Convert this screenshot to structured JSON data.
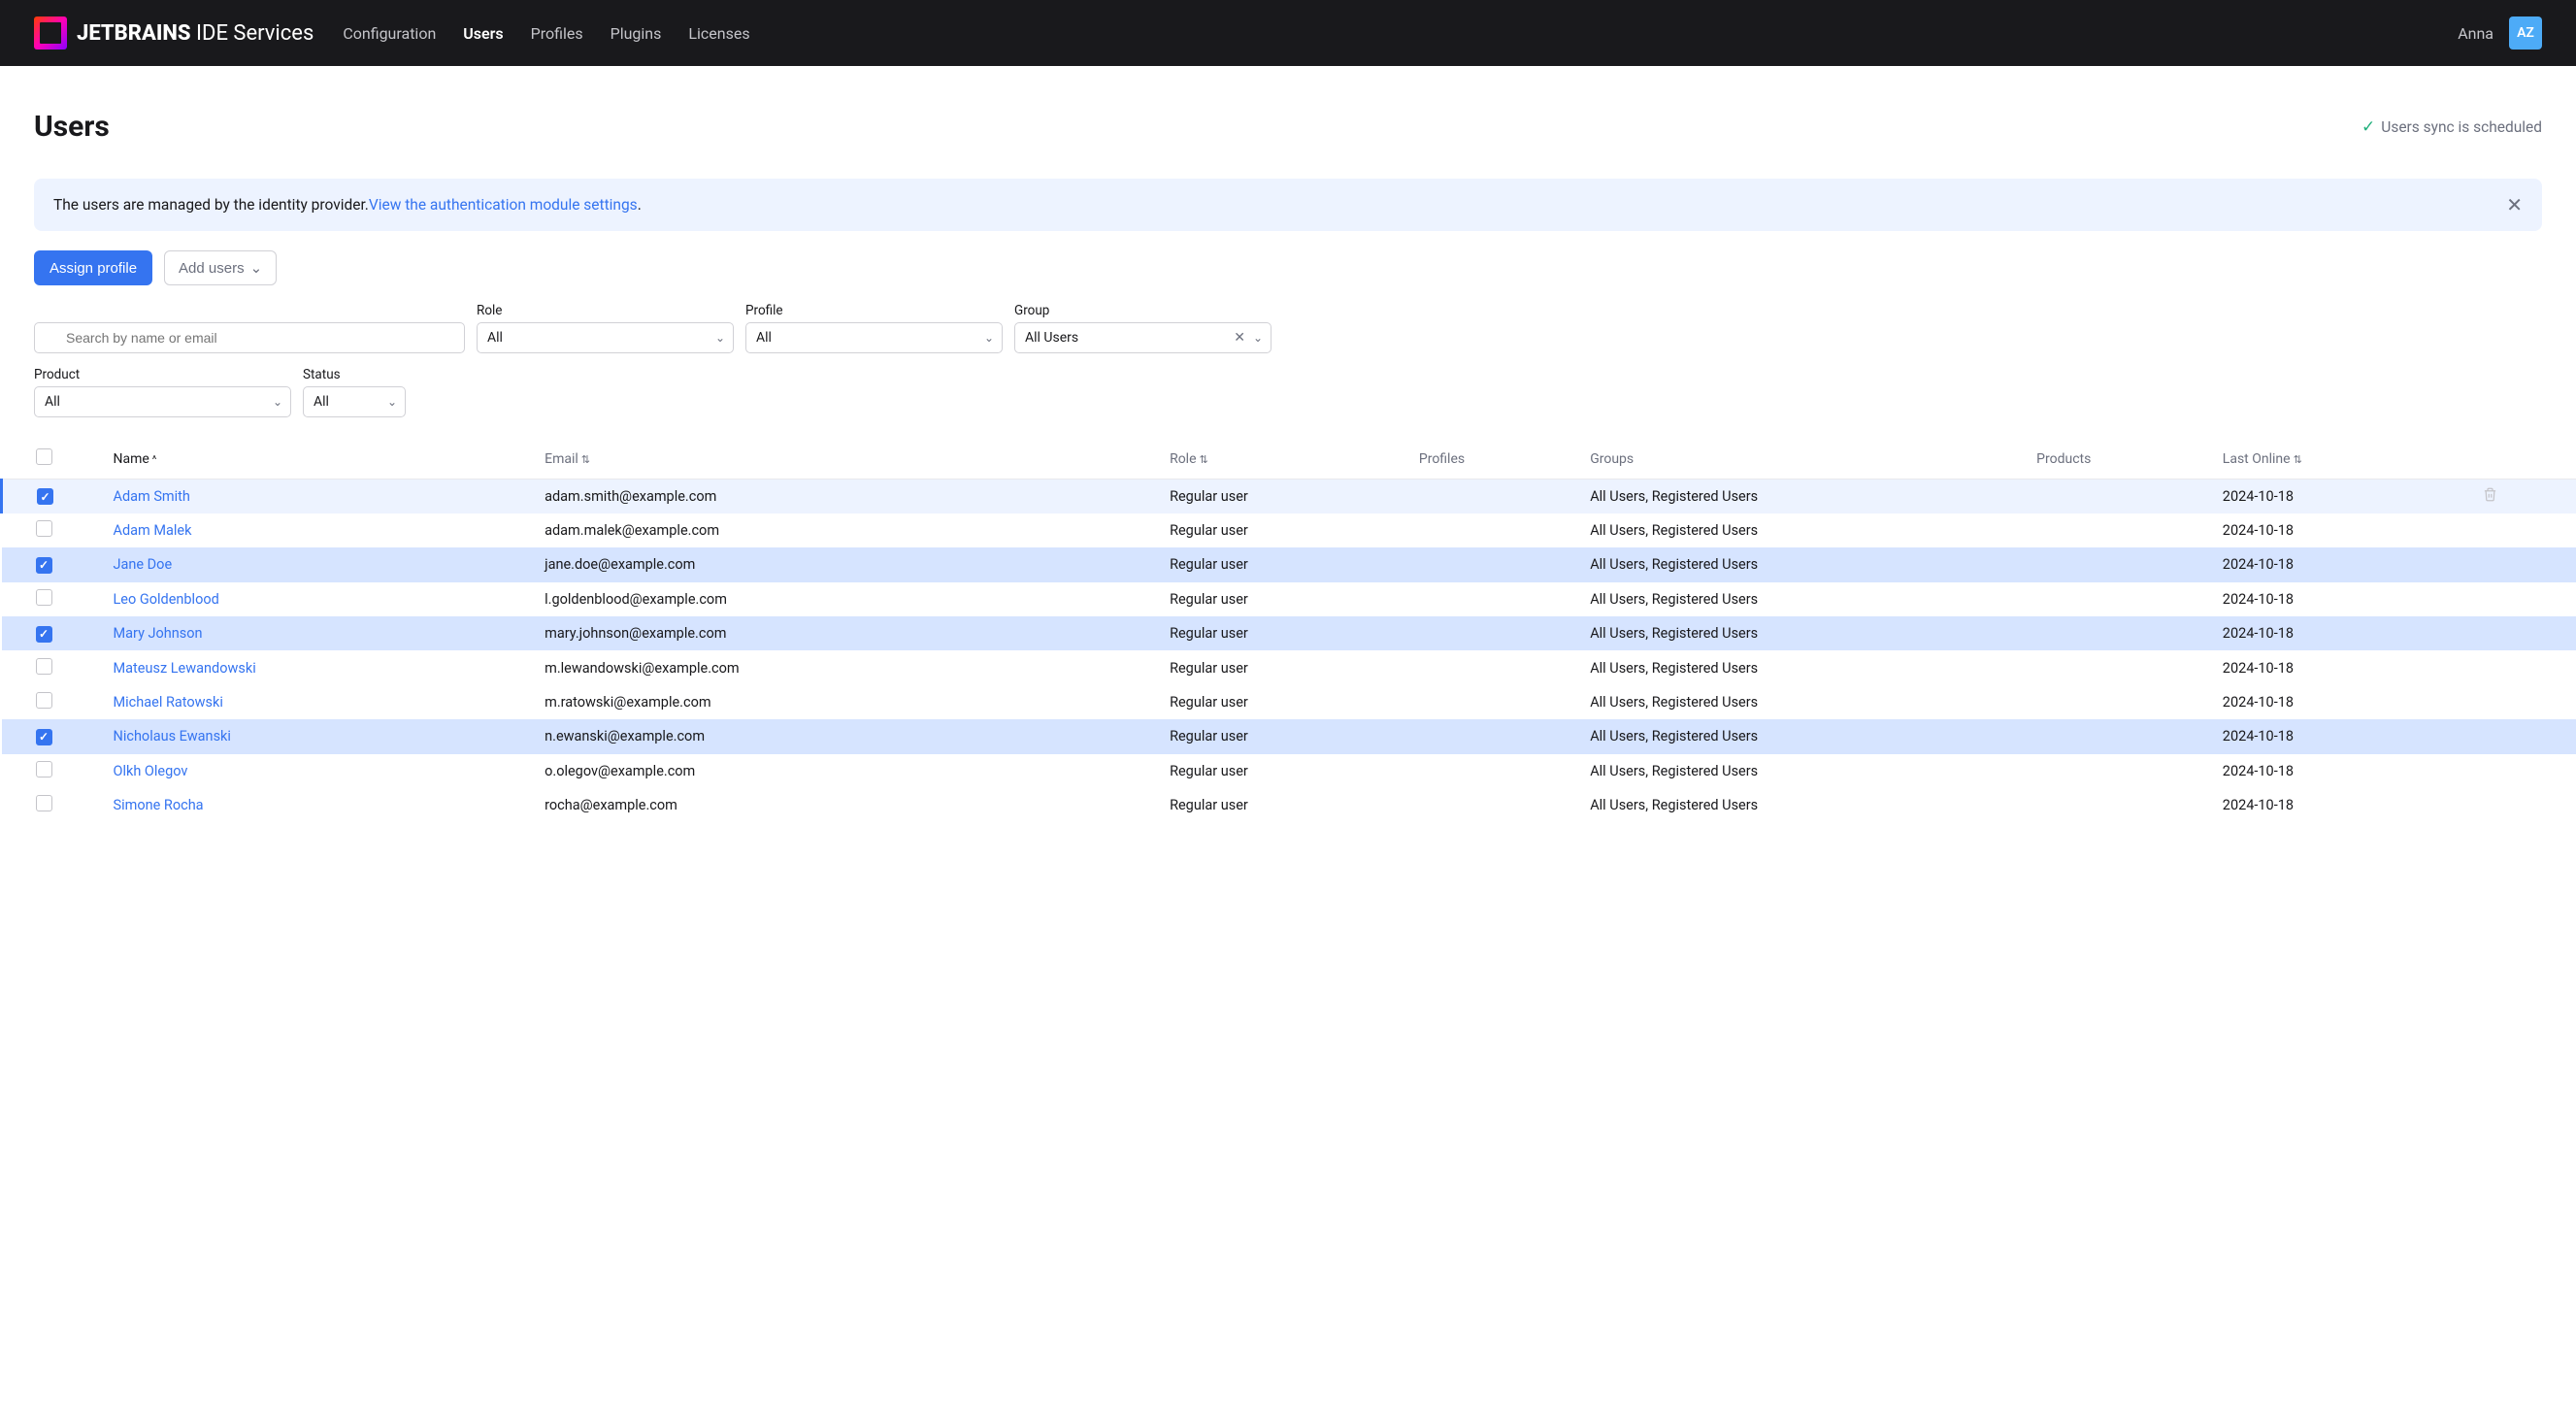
{
  "header": {
    "logo_bold": "JETBRAINS",
    "logo_rest": " IDE Services",
    "nav": [
      "Configuration",
      "Users",
      "Profiles",
      "Plugins",
      "Licenses"
    ],
    "active_nav": "Users",
    "user_name": "Anna",
    "avatar": "AZ"
  },
  "page": {
    "title": "Users",
    "sync_status": "Users sync is scheduled"
  },
  "banner": {
    "text_prefix": "The users are managed by the identity provider. ",
    "link_text": "View the authentication module settings",
    "text_suffix": "."
  },
  "actions": {
    "assign_profile": "Assign profile",
    "add_users": "Add users"
  },
  "filters": {
    "search_placeholder": "Search by name or email",
    "role_label": "Role",
    "role_value": "All",
    "profile_label": "Profile",
    "profile_value": "All",
    "group_label": "Group",
    "group_value": "All Users",
    "product_label": "Product",
    "product_value": "All",
    "status_label": "Status",
    "status_value": "All"
  },
  "columns": {
    "name": "Name",
    "email": "Email",
    "role": "Role",
    "profiles": "Profiles",
    "groups": "Groups",
    "products": "Products",
    "last_online": "Last Online"
  },
  "rows": [
    {
      "selected": true,
      "hover": true,
      "name": "Adam Smith",
      "email": "adam.smith@example.com",
      "role": "Regular user",
      "groups": "All Users, Registered Users",
      "last": "2024-10-18"
    },
    {
      "selected": false,
      "name": "Adam Malek",
      "email": "adam.malek@example.com",
      "role": "Regular user",
      "groups": "All Users, Registered Users",
      "last": "2024-10-18"
    },
    {
      "selected": true,
      "name": "Jane Doe",
      "email": "jane.doe@example.com",
      "role": "Regular user",
      "groups": "All Users, Registered Users",
      "last": "2024-10-18"
    },
    {
      "selected": false,
      "name": "Leo Goldenblood",
      "email": "l.goldenblood@example.com",
      "role": "Regular user",
      "groups": "All Users, Registered Users",
      "last": "2024-10-18"
    },
    {
      "selected": true,
      "name": "Mary Johnson",
      "email": "mary.johnson@example.com",
      "role": "Regular user",
      "groups": "All Users, Registered Users",
      "last": "2024-10-18"
    },
    {
      "selected": false,
      "name": "Mateusz Lewandowski",
      "email": "m.lewandowski@example.com",
      "role": "Regular user",
      "groups": "All Users, Registered Users",
      "last": "2024-10-18"
    },
    {
      "selected": false,
      "name": "Michael Ratowski",
      "email": "m.ratowski@example.com",
      "role": "Regular user",
      "groups": "All Users, Registered Users",
      "last": "2024-10-18"
    },
    {
      "selected": true,
      "name": "Nicholaus Ewanski",
      "email": "n.ewanski@example.com",
      "role": "Regular user",
      "groups": "All Users, Registered Users",
      "last": "2024-10-18"
    },
    {
      "selected": false,
      "name": "Olkh Olegov",
      "email": "o.olegov@example.com",
      "role": "Regular user",
      "groups": "All Users, Registered Users",
      "last": "2024-10-18"
    },
    {
      "selected": false,
      "name": "Simone Rocha",
      "email": "rocha@example.com",
      "role": "Regular user",
      "groups": "All Users, Registered Users",
      "last": "2024-10-18"
    }
  ]
}
